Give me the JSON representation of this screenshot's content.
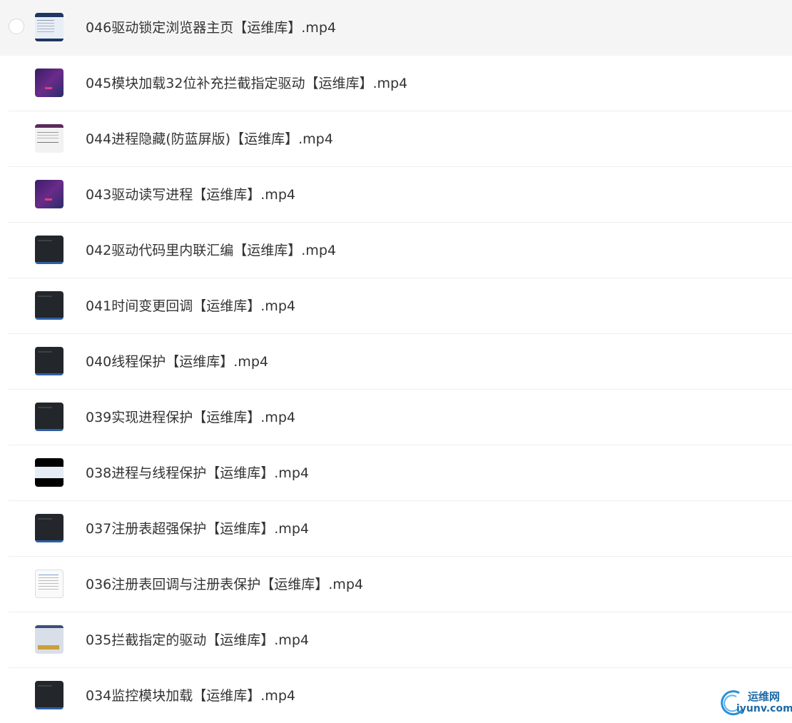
{
  "files": [
    {
      "name": "046驱动锁定浏览器主页【运维库】.mp4",
      "thumb": "window",
      "selected": true
    },
    {
      "name": "045模块加载32位补充拦截指定驱动【运维库】.mp4",
      "thumb": "purple"
    },
    {
      "name": "044进程隐藏(防蓝屏版)【运维库】.mp4",
      "thumb": "light"
    },
    {
      "name": "043驱动读写进程【运维库】.mp4",
      "thumb": "purple"
    },
    {
      "name": "042驱动代码里内联汇编【运维库】.mp4",
      "thumb": "dark"
    },
    {
      "name": "041时间变更回调【运维库】.mp4",
      "thumb": "dark"
    },
    {
      "name": "040线程保护【运维库】.mp4",
      "thumb": "dark"
    },
    {
      "name": "039实现进程保护【运维库】.mp4",
      "thumb": "dark"
    },
    {
      "name": "038进程与线程保护【运维库】.mp4",
      "thumb": "black"
    },
    {
      "name": "037注册表超强保护【运维库】.mp4",
      "thumb": "dark"
    },
    {
      "name": "036注册表回调与注册表保护【运维库】.mp4",
      "thumb": "doc"
    },
    {
      "name": "035拦截指定的驱动【运维库】.mp4",
      "thumb": "grid"
    },
    {
      "name": "034监控模块加载【运维库】.mp4",
      "thumb": "dark"
    }
  ],
  "watermark": {
    "cn": "运维网",
    "en": "iyunv.com"
  }
}
